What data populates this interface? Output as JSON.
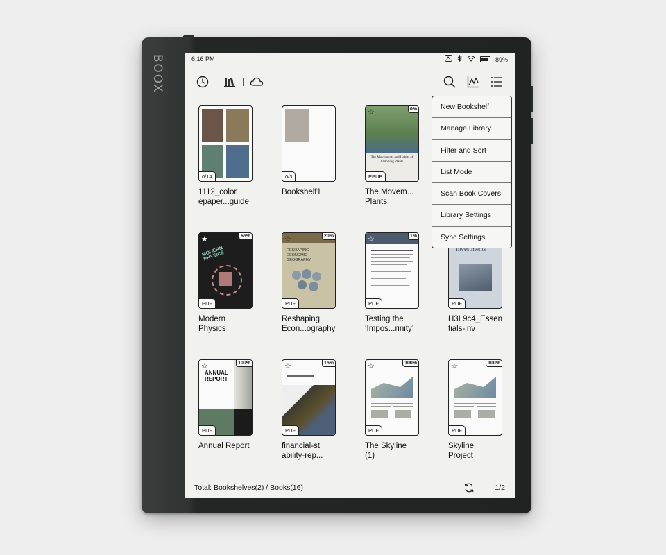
{
  "device": {
    "brand": "BOOX"
  },
  "status_bar": {
    "time": "6:16 PM",
    "battery": "89%"
  },
  "toolbar": {
    "left_icons": [
      "clock-icon",
      "bookshelf-icon",
      "cloud-icon"
    ],
    "right_icons": [
      "search-icon",
      "stats-icon",
      "menu-list-icon"
    ]
  },
  "books": [
    {
      "title": "1112_color\nepaper...guide",
      "badge": "0/14",
      "progress": "",
      "starred": false
    },
    {
      "title": "Bookshelf1",
      "badge": "0/3",
      "progress": "",
      "starred": false
    },
    {
      "title": "The Movem...\nPlants",
      "badge": "EPUB",
      "progress": "0%",
      "starred": true
    },
    {
      "title": "",
      "badge": "",
      "progress": "",
      "starred": false
    },
    {
      "title": "Modern\nPhysics",
      "badge": "PDF",
      "progress": "65%",
      "starred": true
    },
    {
      "title": "Reshaping\nEcon...ography",
      "badge": "PDF",
      "progress": "20%",
      "starred": true
    },
    {
      "title": "Testing the\n‘Impos...rinity’",
      "badge": "PDF",
      "progress": "1%",
      "starred": true
    },
    {
      "title": "H3L9c4_Essen\ntials-inv",
      "badge": "PDF",
      "progress": "",
      "starred": false
    },
    {
      "title": "Annual Report",
      "badge": "PDF",
      "progress": "100%",
      "starred": true
    },
    {
      "title": "financial-st\nability-rep...",
      "badge": "PDF",
      "progress": "15%",
      "starred": true
    },
    {
      "title": "The Skyline\n(1)",
      "badge": "PDF",
      "progress": "100%",
      "starred": true
    },
    {
      "title": "Skyline\nProject",
      "badge": "PDF",
      "progress": "100%",
      "starred": true
    }
  ],
  "cover_text": {
    "movements": "The Movements and Habits of Climbing Plants",
    "physics": "MODERN PHYSICS",
    "geography": "RESHAPING ECONOMIC GEOGRAPHY",
    "essentials": "Essentials of Investments",
    "annual": "ANNUAL REPORT"
  },
  "menu": {
    "items": [
      "New Bookshelf",
      "Manage Library",
      "Filter and Sort",
      "List Mode",
      "Scan Book Covers",
      "Library Settings",
      "Sync Settings"
    ]
  },
  "footer": {
    "total": "Total: Bookshelves(2) / Books(16)",
    "page": "1/2"
  }
}
